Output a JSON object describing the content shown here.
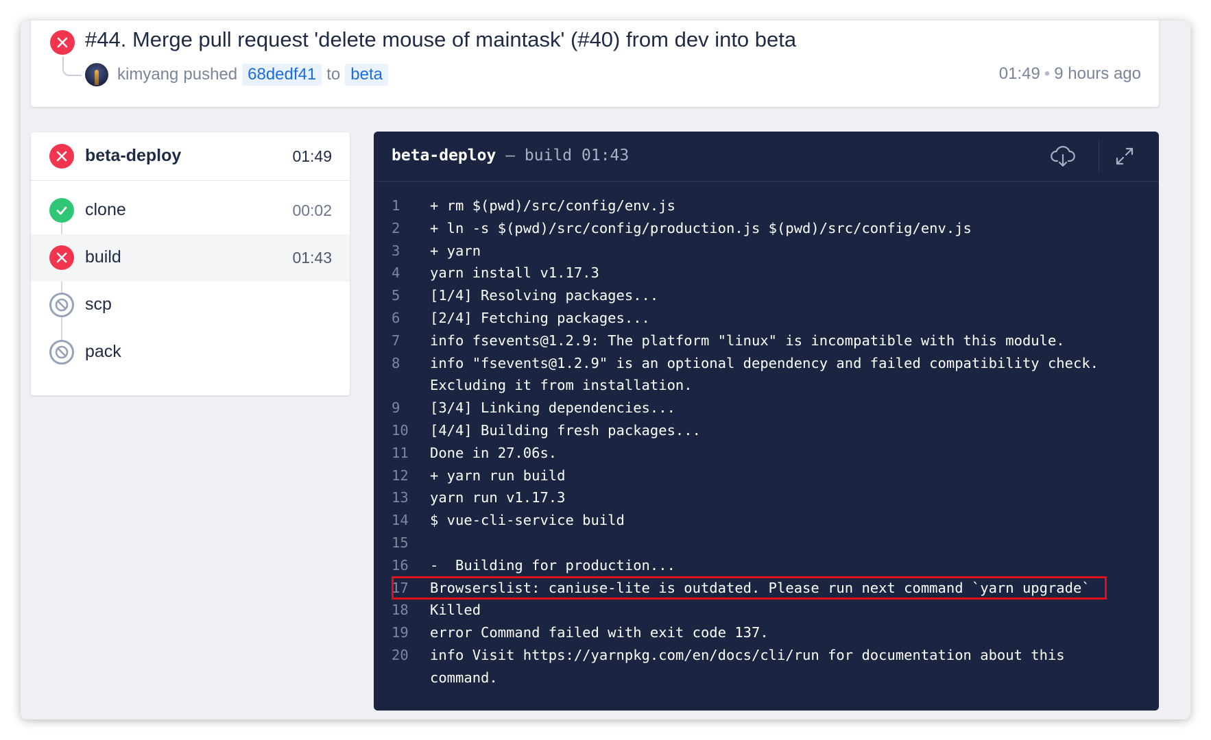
{
  "build": {
    "title": "#44. Merge pull request 'delete mouse of maintask' (#40) from dev into beta",
    "status": "failed",
    "author": "kimyang",
    "action": "pushed",
    "commit": "68dedf41",
    "to_label": "to",
    "branch": "beta",
    "time": "01:49",
    "separator": "•",
    "relative_time": "9 hours ago"
  },
  "stage": {
    "name": "beta-deploy",
    "status": "failed",
    "time": "01:49",
    "steps": [
      {
        "name": "clone",
        "status": "success",
        "time": "00:02"
      },
      {
        "name": "build",
        "status": "failed",
        "time": "01:43"
      },
      {
        "name": "scp",
        "status": "skipped",
        "time": ""
      },
      {
        "name": "pack",
        "status": "skipped",
        "time": ""
      }
    ]
  },
  "log": {
    "stage": "beta-deploy",
    "dash": "—",
    "step": "build",
    "time": "01:43",
    "download_icon": "cloud-download-icon",
    "expand_icon": "expand-icon",
    "highlighted_line": 17,
    "lines": [
      {
        "n": "1",
        "text": "+ rm $(pwd)/src/config/env.js"
      },
      {
        "n": "2",
        "text": "+ ln -s $(pwd)/src/config/production.js $(pwd)/src/config/env.js"
      },
      {
        "n": "3",
        "text": "+ yarn"
      },
      {
        "n": "4",
        "text": "yarn install v1.17.3"
      },
      {
        "n": "5",
        "text": "[1/4] Resolving packages..."
      },
      {
        "n": "6",
        "text": "[2/4] Fetching packages..."
      },
      {
        "n": "7",
        "text": "info fsevents@1.2.9: The platform \"linux\" is incompatible with this module."
      },
      {
        "n": "8",
        "text": "info \"fsevents@1.2.9\" is an optional dependency and failed compatibility check. Excluding it from installation."
      },
      {
        "n": "9",
        "text": "[3/4] Linking dependencies..."
      },
      {
        "n": "10",
        "text": "[4/4] Building fresh packages..."
      },
      {
        "n": "11",
        "text": "Done in 27.06s."
      },
      {
        "n": "12",
        "text": "+ yarn run build"
      },
      {
        "n": "13",
        "text": "yarn run v1.17.3"
      },
      {
        "n": "14",
        "text": "$ vue-cli-service build"
      },
      {
        "n": "15",
        "text": ""
      },
      {
        "n": "16",
        "text": "-  Building for production..."
      },
      {
        "n": "17",
        "text": "Browserslist: caniuse-lite is outdated. Please run next command `yarn upgrade`"
      },
      {
        "n": "18",
        "text": "Killed"
      },
      {
        "n": "19",
        "text": "error Command failed with exit code 137."
      },
      {
        "n": "20",
        "text": "info Visit https://yarnpkg.com/en/docs/cli/run for documentation about this command."
      }
    ]
  },
  "colors": {
    "failed": "#f1354e",
    "success": "#2fc776",
    "skipped": "#96a2b8",
    "log_bg": "#1b2541",
    "link": "#1a6ee0",
    "highlight": "#e3101a"
  }
}
